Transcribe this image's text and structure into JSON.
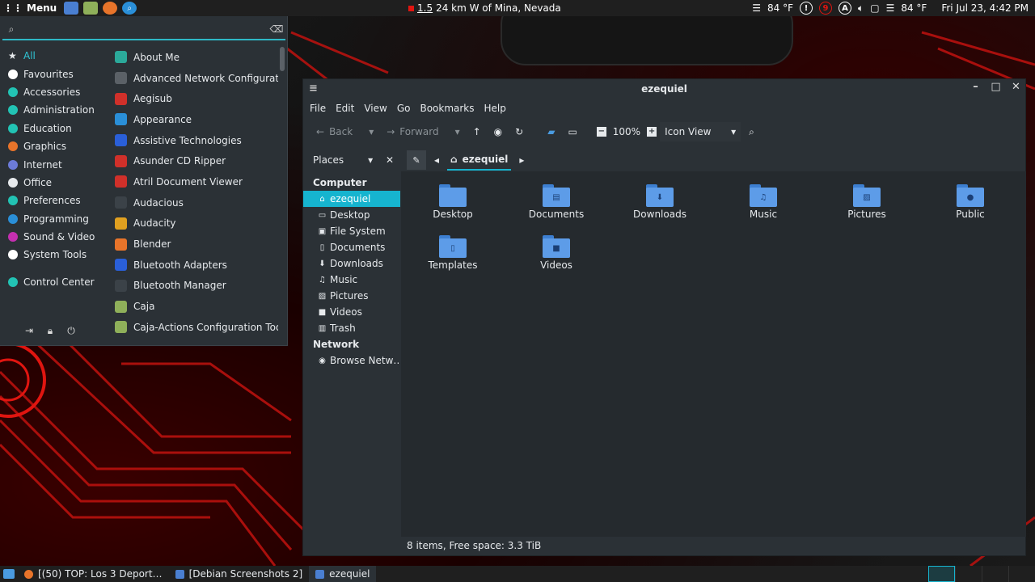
{
  "top_panel": {
    "menu_label": "Menu",
    "location_text": "1.5 24 km W of Mina, Nevada",
    "location_mag": "1.5",
    "location_place": "24 km W of Mina, Nevada",
    "temp1": "84 °F",
    "notify_count": "9",
    "temp2": "84 °F",
    "clock": "Fri Jul 23,  4:42 PM"
  },
  "app_menu": {
    "search_value": "",
    "categories": [
      {
        "label": "All",
        "color": "#e6e9ec"
      },
      {
        "label": "Favourites",
        "color": "#ffffff"
      },
      {
        "label": "Accessories",
        "color": "#22c3b4"
      },
      {
        "label": "Administration",
        "color": "#22c3b4"
      },
      {
        "label": "Education",
        "color": "#22c3b4"
      },
      {
        "label": "Graphics",
        "color": "#e8742a"
      },
      {
        "label": "Internet",
        "color": "#6c7bd8"
      },
      {
        "label": "Office",
        "color": "#e6e9ec"
      },
      {
        "label": "Preferences",
        "color": "#22c3b4"
      },
      {
        "label": "Programming",
        "color": "#2a8fd8"
      },
      {
        "label": "Sound & Video",
        "color": "#c42fb0"
      },
      {
        "label": "System Tools",
        "color": "#ffffff"
      }
    ],
    "control_center": "Control Center",
    "apps": [
      {
        "label": "About Me",
        "color": "#2ba99a"
      },
      {
        "label": "Advanced Network Configuration",
        "color": "#5b6167"
      },
      {
        "label": "Aegisub",
        "color": "#d0302a"
      },
      {
        "label": "Appearance",
        "color": "#2a8fd8"
      },
      {
        "label": "Assistive Technologies",
        "color": "#2a5fd8"
      },
      {
        "label": "Asunder CD Ripper",
        "color": "#d0302a"
      },
      {
        "label": "Atril Document Viewer",
        "color": "#d0302a"
      },
      {
        "label": "Audacious",
        "color": "#3b4248"
      },
      {
        "label": "Audacity",
        "color": "#e0a020"
      },
      {
        "label": "Blender",
        "color": "#e8742a"
      },
      {
        "label": "Bluetooth Adapters",
        "color": "#2a5fd8"
      },
      {
        "label": "Bluetooth Manager",
        "color": "#3b4248"
      },
      {
        "label": "Caja",
        "color": "#8fb05a"
      },
      {
        "label": "Caja-Actions Configuration Tool",
        "color": "#8fb05a"
      }
    ]
  },
  "file_manager": {
    "title": "ezequiel",
    "menu": [
      "File",
      "Edit",
      "View",
      "Go",
      "Bookmarks",
      "Help"
    ],
    "toolbar": {
      "back": "Back",
      "forward": "Forward",
      "zoom": "100%",
      "view_mode": "Icon View"
    },
    "places_label": "Places",
    "sidebar": {
      "computer_heading": "Computer",
      "computer_items": [
        {
          "label": "ezequiel",
          "icon": "⌂"
        },
        {
          "label": "Desktop",
          "icon": "▭"
        },
        {
          "label": "File System",
          "icon": "▣"
        },
        {
          "label": "Documents",
          "icon": "▯"
        },
        {
          "label": "Downloads",
          "icon": "⬇"
        },
        {
          "label": "Music",
          "icon": "♫"
        },
        {
          "label": "Pictures",
          "icon": "▨"
        },
        {
          "label": "Videos",
          "icon": "■"
        },
        {
          "label": "Trash",
          "icon": "▥"
        }
      ],
      "network_heading": "Network",
      "network_items": [
        {
          "label": "Browse Netw…",
          "icon": "◉"
        }
      ]
    },
    "path": "ezequiel",
    "folders": [
      {
        "label": "Desktop",
        "glyph": ""
      },
      {
        "label": "Documents",
        "glyph": "▤"
      },
      {
        "label": "Downloads",
        "glyph": "⬇"
      },
      {
        "label": "Music",
        "glyph": "♫"
      },
      {
        "label": "Pictures",
        "glyph": "▨"
      },
      {
        "label": "Public",
        "glyph": "●"
      },
      {
        "label": "Templates",
        "glyph": "▯"
      },
      {
        "label": "Videos",
        "glyph": "■"
      }
    ],
    "status": "8 items, Free space: 3.3 TiB"
  },
  "bottom_panel": {
    "tasks": [
      {
        "label": "[(50) TOP: Los 3 Deport…",
        "color": "#e8742a"
      },
      {
        "label": "[Debian Screenshots 2]",
        "color": "#4a7fd1"
      },
      {
        "label": "ezequiel",
        "color": "#4a7fd1"
      }
    ]
  }
}
